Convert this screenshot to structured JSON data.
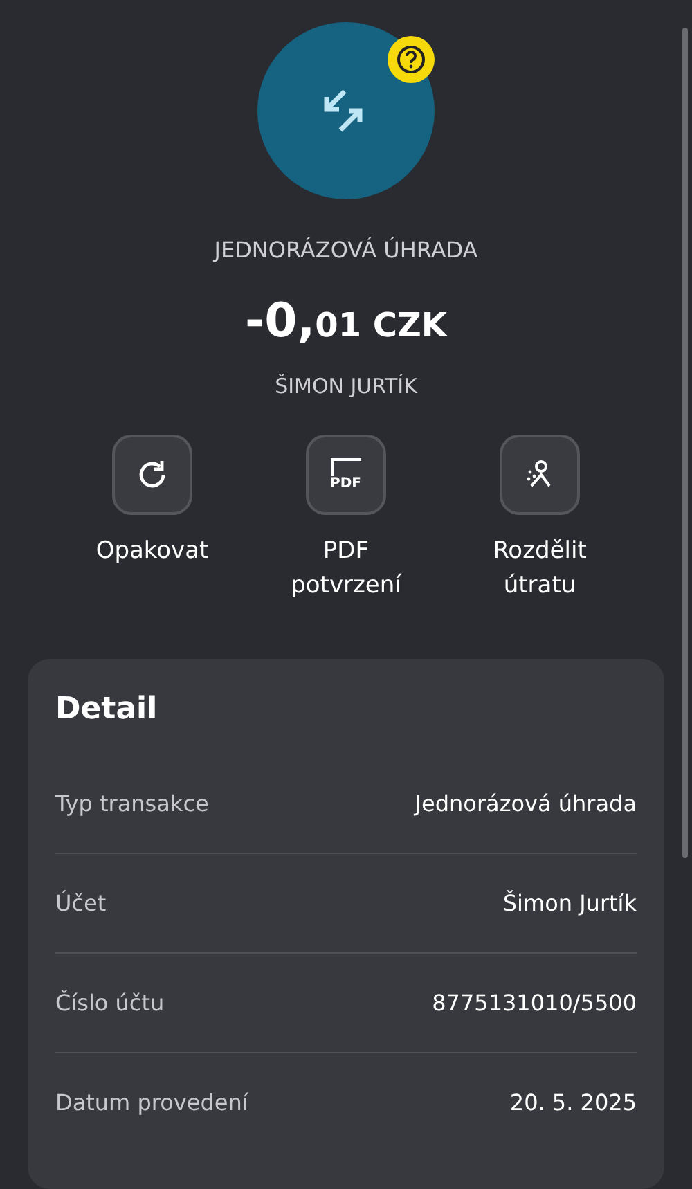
{
  "header": {
    "title": "JEDNORÁZOVÁ ÚHRADA",
    "amount_main": "-0,",
    "amount_rest": "01 CZK",
    "counterparty": "ŠIMON JURTÍK"
  },
  "actions": [
    {
      "kind": "repeat",
      "label": "Opakovat"
    },
    {
      "kind": "pdf",
      "icon_text": "PDF",
      "label": "PDF\npotvrzení"
    },
    {
      "kind": "split",
      "label": "Rozdělit\nútratu"
    }
  ],
  "detail": {
    "title": "Detail",
    "rows": [
      {
        "label": "Typ transakce",
        "value": "Jednorázová úhrada"
      },
      {
        "label": "Účet",
        "value": "Šimon Jurtík"
      },
      {
        "label": "Číslo účtu",
        "value": "8775131010/5500"
      },
      {
        "label": "Datum provedení",
        "value": "20. 5. 2025"
      }
    ]
  }
}
